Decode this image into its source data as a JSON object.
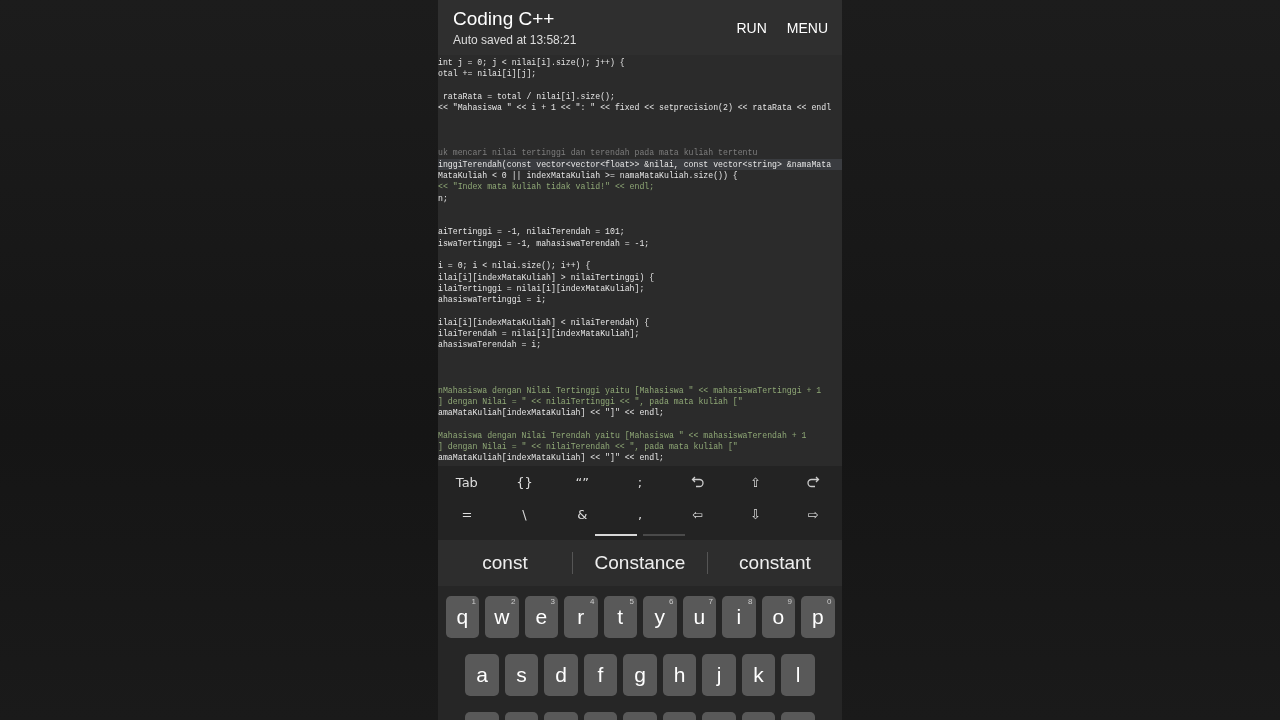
{
  "app_bar": {
    "title": "Coding C++",
    "subtitle": "Auto saved at 13:58:21",
    "actions": [
      "RUN",
      "MENU"
    ]
  },
  "editor": {
    "lines": [
      {
        "kind": "code",
        "text": "int j = 0; j < nilai[i].size(); j++) {",
        "highlighted": false
      },
      {
        "kind": "code",
        "text": "otal += nilai[i][j];",
        "highlighted": false
      },
      {
        "kind": "blank",
        "highlighted": false
      },
      {
        "kind": "code",
        "text": " rataRata = total / nilai[i].size();",
        "highlighted": false
      },
      {
        "kind": "code",
        "text": "<< \"Mahasiswa \" << i + 1 << \": \" << fixed << setprecision(2) << rataRata << endl",
        "highlighted": false
      },
      {
        "kind": "blank",
        "highlighted": false
      },
      {
        "kind": "blank",
        "highlighted": false
      },
      {
        "kind": "blank",
        "highlighted": false
      },
      {
        "kind": "comment",
        "text": "uk mencari nilai tertinggi dan terendah pada mata kuliah tertentu",
        "highlighted": false
      },
      {
        "kind": "code",
        "text": "inggiTerendah(const vector<vector<float>> &nilai, const vector<string> &namaMata",
        "highlighted": true
      },
      {
        "kind": "code",
        "text": "MataKuliah < 0 || indexMataKuliah >= namaMataKuliah.size()) {",
        "highlighted": false
      },
      {
        "kind": "string",
        "text": "<< \"Index mata kuliah tidak valid!\" << endl;",
        "highlighted": false
      },
      {
        "kind": "code",
        "text": "n;",
        "highlighted": false
      },
      {
        "kind": "blank",
        "highlighted": false
      },
      {
        "kind": "blank",
        "highlighted": false
      },
      {
        "kind": "code",
        "text": "aiTertinggi = -1, nilaiTerendah = 101;",
        "highlighted": false
      },
      {
        "kind": "code",
        "text": "iswaTertinggi = -1, mahasiswaTerendah = -1;",
        "highlighted": false
      },
      {
        "kind": "blank",
        "highlighted": false
      },
      {
        "kind": "code",
        "text": "i = 0; i < nilai.size(); i++) {",
        "highlighted": false
      },
      {
        "kind": "code",
        "text": "ilai[i][indexMataKuliah] > nilaiTertinggi) {",
        "highlighted": false
      },
      {
        "kind": "code",
        "text": "ilaiTertinggi = nilai[i][indexMataKuliah];",
        "highlighted": false
      },
      {
        "kind": "code",
        "text": "ahasiswaTertinggi = i;",
        "highlighted": false
      },
      {
        "kind": "blank",
        "highlighted": false
      },
      {
        "kind": "code",
        "text": "ilai[i][indexMataKuliah] < nilaiTerendah) {",
        "highlighted": false
      },
      {
        "kind": "code",
        "text": "ilaiTerendah = nilai[i][indexMataKuliah];",
        "highlighted": false
      },
      {
        "kind": "code",
        "text": "ahasiswaTerendah = i;",
        "highlighted": false
      },
      {
        "kind": "blank",
        "highlighted": false
      },
      {
        "kind": "blank",
        "highlighted": false
      },
      {
        "kind": "blank",
        "highlighted": false
      },
      {
        "kind": "string",
        "text": "nMahasiswa dengan Nilai Tertinggi yaitu [Mahasiswa \" << mahasiswaTertinggi + 1",
        "highlighted": false
      },
      {
        "kind": "string",
        "text": "] dengan Nilai = \" << nilaiTertinggi << \", pada mata kuliah [\"",
        "highlighted": false
      },
      {
        "kind": "code",
        "text": "amaMataKuliah[indexMataKuliah] << \"]\" << endl;",
        "highlighted": false
      },
      {
        "kind": "blank",
        "highlighted": false
      },
      {
        "kind": "string",
        "text": "Mahasiswa dengan Nilai Terendah yaitu [Mahasiswa \" << mahasiswaTerendah + 1",
        "highlighted": false
      },
      {
        "kind": "string",
        "text": "] dengan Nilai = \" << nilaiTerendah << \", pada mata kuliah [\"",
        "highlighted": false
      },
      {
        "kind": "code",
        "text": "amaMataKuliah[indexMataKuliah] << \"]\" << endl;",
        "highlighted": false
      }
    ]
  },
  "extra_keys": [
    [
      {
        "kind": "text",
        "label": "Tab"
      },
      {
        "kind": "text",
        "label": "{}"
      },
      {
        "kind": "text",
        "label": "“”"
      },
      {
        "kind": "text",
        "label": ";"
      },
      {
        "kind": "undo"
      },
      {
        "kind": "text",
        "label": "⇧"
      },
      {
        "kind": "redo"
      }
    ],
    [
      {
        "kind": "text",
        "label": "="
      },
      {
        "kind": "text",
        "label": "\\"
      },
      {
        "kind": "text",
        "label": "&"
      },
      {
        "kind": "text",
        "label": ","
      },
      {
        "kind": "text",
        "label": "⇦"
      },
      {
        "kind": "text",
        "label": "⇩"
      },
      {
        "kind": "text",
        "label": "⇨"
      }
    ]
  ],
  "extra_key_pages": [
    {
      "selected": true
    },
    {
      "selected": false
    }
  ],
  "suggestions": [
    "const",
    "Constance",
    "constant"
  ],
  "keyboard": {
    "rows": [
      [
        {
          "key": "q",
          "hint": "1"
        },
        {
          "key": "w",
          "hint": "2"
        },
        {
          "key": "e",
          "hint": "3"
        },
        {
          "key": "r",
          "hint": "4"
        },
        {
          "key": "t",
          "hint": "5"
        },
        {
          "key": "y",
          "hint": "6"
        },
        {
          "key": "u",
          "hint": "7"
        },
        {
          "key": "i",
          "hint": "8"
        },
        {
          "key": "o",
          "hint": "9"
        },
        {
          "key": "p",
          "hint": "0"
        }
      ],
      [
        {
          "key": "a"
        },
        {
          "key": "s"
        },
        {
          "key": "d"
        },
        {
          "key": "f"
        },
        {
          "key": "g"
        },
        {
          "key": "h"
        },
        {
          "key": "j"
        },
        {
          "key": "k"
        },
        {
          "key": "l"
        }
      ]
    ]
  }
}
